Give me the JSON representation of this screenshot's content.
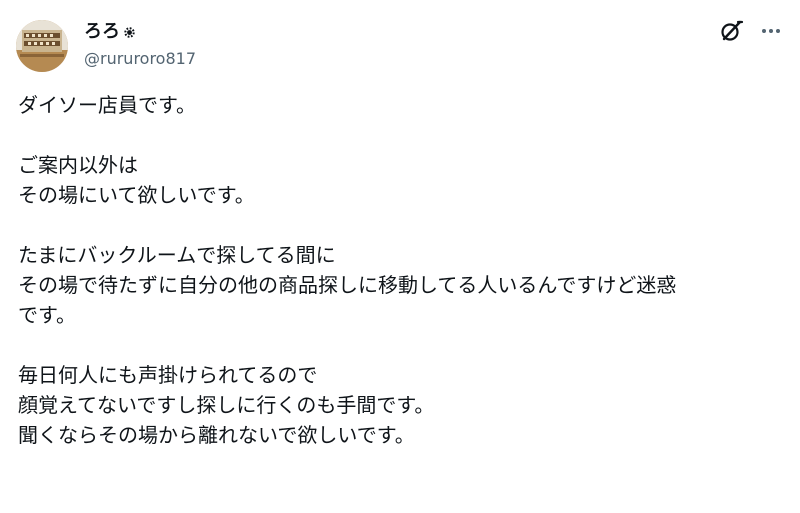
{
  "author": {
    "display_name": "ろろ",
    "handle": "@rururoro817",
    "avatar_icon": "avatar-image",
    "badge_icon": "gear-badge-icon"
  },
  "actions": {
    "grok_icon": "grok-icon",
    "more_icon": "more-options-icon"
  },
  "post": {
    "paragraphs": [
      {
        "lines": [
          "ダイソー店員です。"
        ]
      },
      {
        "lines": [
          "ご案内以外は",
          "その場にいて欲しいです。"
        ]
      },
      {
        "lines": [
          "たまにバックルームで探してる間に",
          "その場で待たずに自分の他の商品探しに移動してる人いるんですけど迷惑",
          "です。"
        ]
      },
      {
        "lines": [
          "毎日何人にも声掛けられてるので",
          "顔覚えてないですし探しに行くのも手間です。",
          "聞くならその場から離れないで欲しいです。"
        ]
      }
    ]
  },
  "colors": {
    "text": "#0f1419",
    "secondary": "#536471"
  }
}
